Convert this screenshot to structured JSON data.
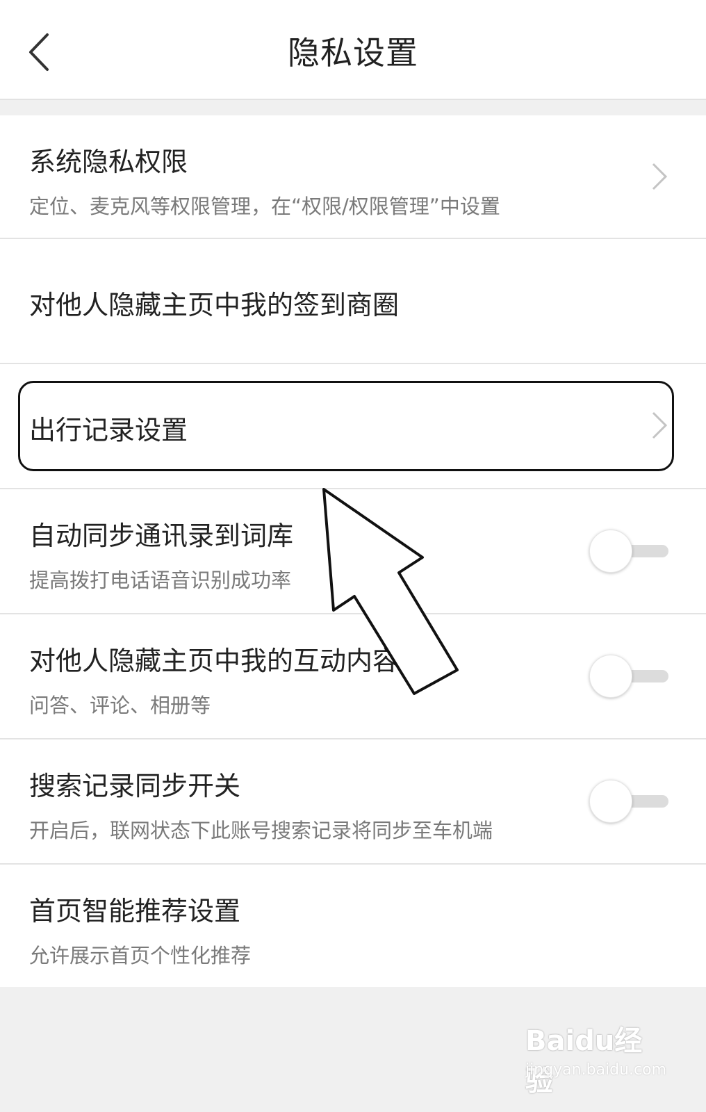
{
  "header": {
    "title": "隐私设置"
  },
  "rows": [
    {
      "main": "系统隐私权限",
      "sub": "定位、麦克风等权限管理，在“权限/权限管理”中设置"
    },
    {
      "main": "对他人隐藏主页中我的签到商圈"
    },
    {
      "main": "出行记录设置"
    },
    {
      "main": "自动同步通讯录到词库",
      "sub": "提高拨打电话语音识别成功率",
      "toggle_state": "off"
    },
    {
      "main": "对他人隐藏主页中我的互动内容",
      "sub": "问答、评论、相册等",
      "toggle_state": "off"
    },
    {
      "main": "搜索记录同步开关",
      "sub": "开启后，联网状态下此账号搜索记录将同步至车机端",
      "toggle_state": "off"
    },
    {
      "main": "首页智能推荐设置",
      "sub": "允许展示首页个性化推荐"
    }
  ],
  "watermark": {
    "brand": "Baidu经验",
    "url": "jingyan.baidu.com"
  },
  "colors": {
    "background": "#f0f0f0",
    "text_primary": "#222222",
    "text_secondary": "#7a7a7a",
    "toggle_track": "#dcdcdc"
  }
}
